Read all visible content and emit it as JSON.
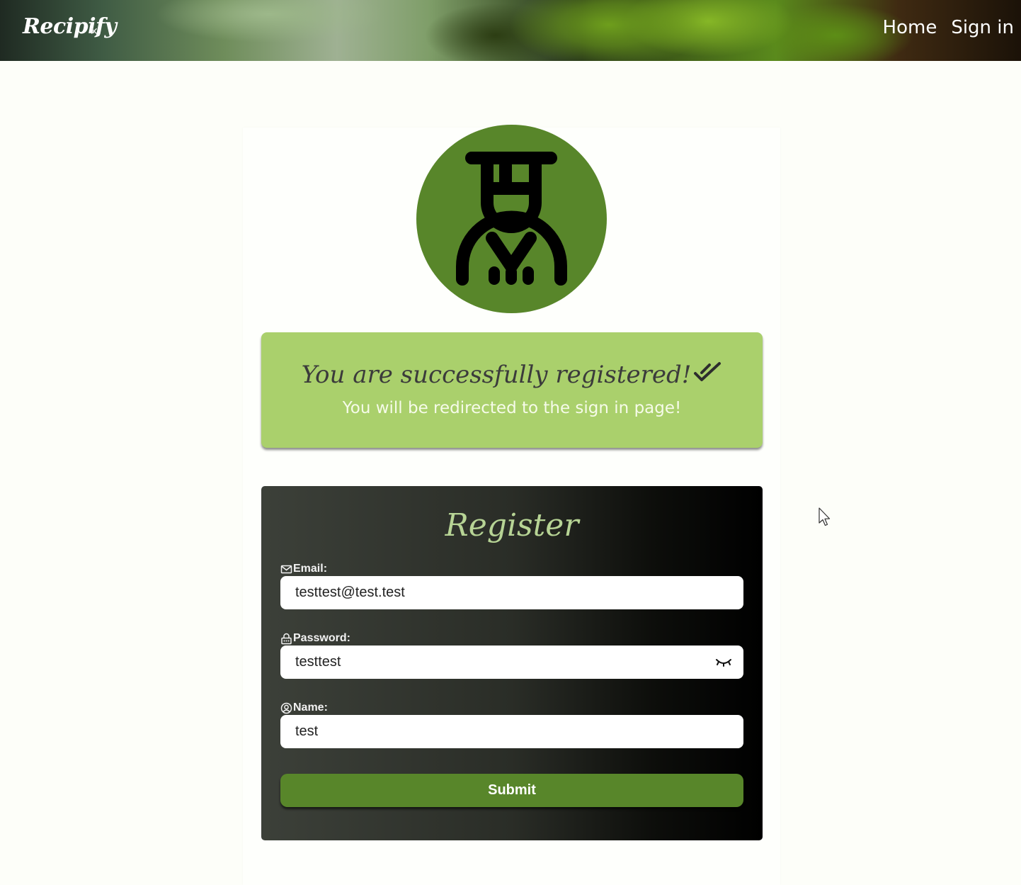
{
  "header": {
    "logo_text": "Recipify",
    "logo_icon": "utensils-icon",
    "nav": [
      {
        "label": "Home"
      },
      {
        "label": "Sign in"
      }
    ]
  },
  "avatar": {
    "icon": "chef-icon",
    "background": "#58862a"
  },
  "success": {
    "title": "You are successfully registered!",
    "title_icon": "double-check-icon",
    "subtitle": "You will be redirected to the sign in page!",
    "background": "#aad06c"
  },
  "register": {
    "title": "Register",
    "email": {
      "label": "Email:",
      "icon": "envelope-icon",
      "value": "testtest@test.test"
    },
    "password": {
      "label": "Password:",
      "icon": "lock-icon",
      "value": "testtest",
      "toggle_icon": "eye-closed-icon"
    },
    "name": {
      "label": "Name:",
      "icon": "user-circle-icon",
      "value": "test"
    },
    "submit_label": "Submit",
    "accent": "#58862a"
  }
}
